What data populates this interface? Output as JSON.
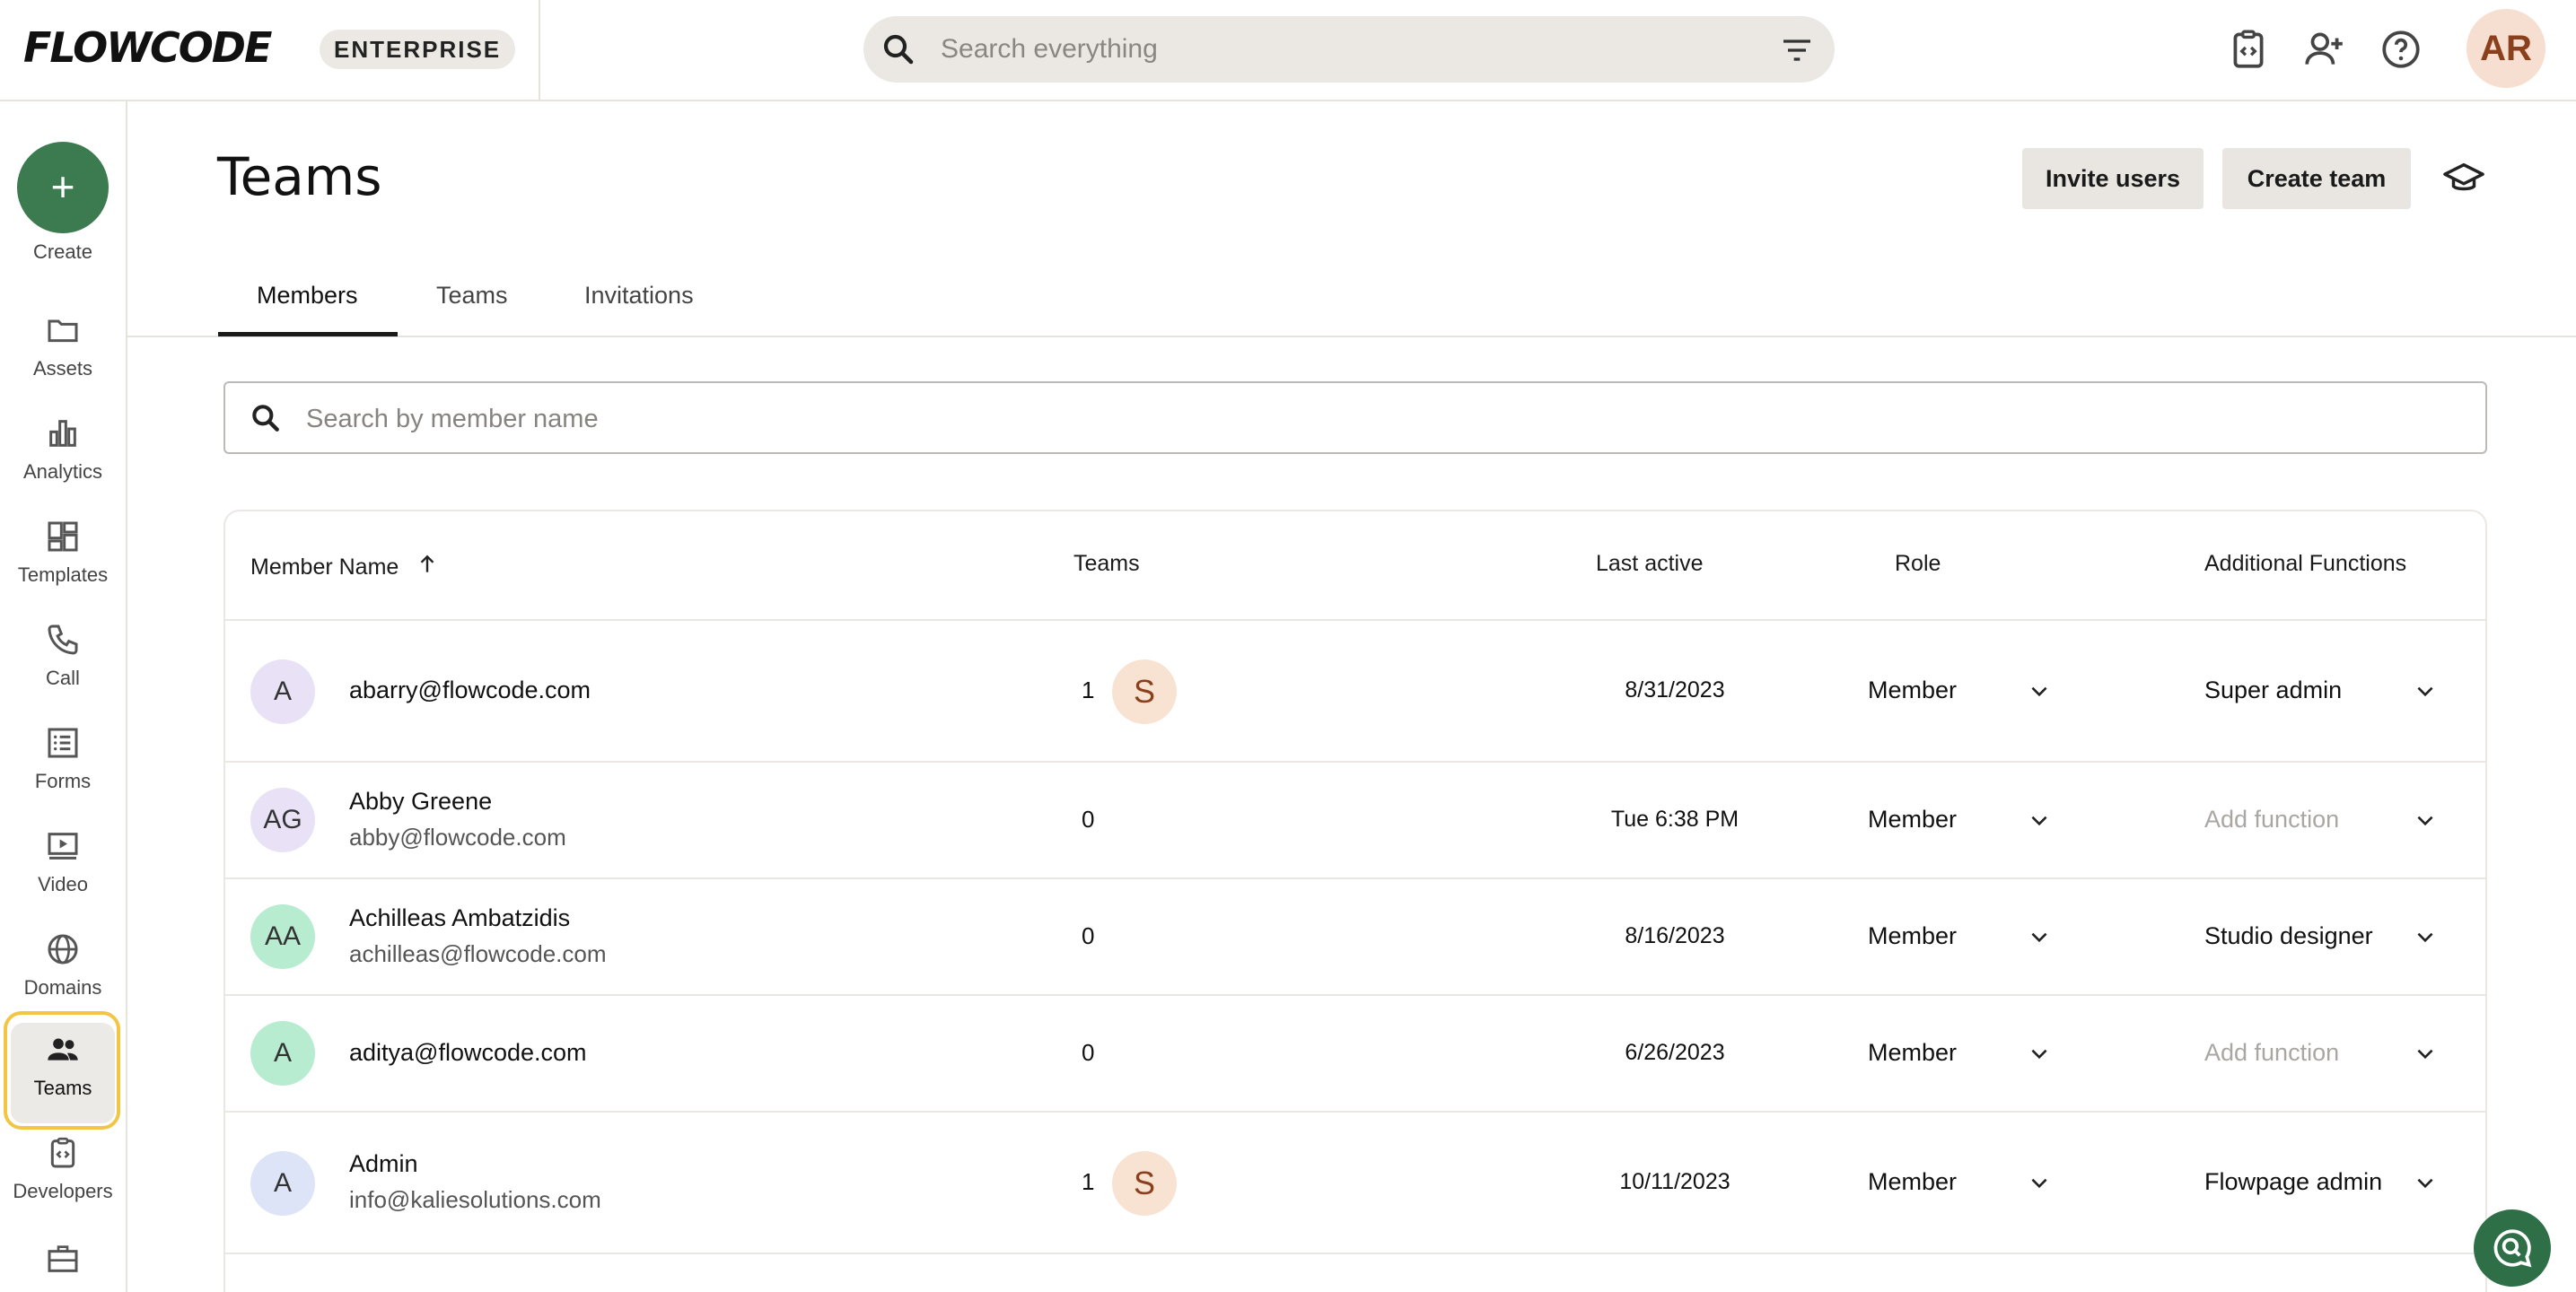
{
  "brand": {
    "logo": "FLOWCODE",
    "plan_badge": "ENTERPRISE"
  },
  "search": {
    "placeholder": "Search everything"
  },
  "user": {
    "initials": "AR"
  },
  "sidebar": {
    "create_label": "Create",
    "items": [
      {
        "label": "Assets",
        "icon": "folder-icon"
      },
      {
        "label": "Analytics",
        "icon": "bar-chart-icon"
      },
      {
        "label": "Templates",
        "icon": "dashboard-icon"
      },
      {
        "label": "Call",
        "icon": "phone-icon"
      },
      {
        "label": "Forms",
        "icon": "form-icon"
      },
      {
        "label": "Video",
        "icon": "video-icon"
      },
      {
        "label": "Domains",
        "icon": "globe-icon"
      },
      {
        "label": "Teams",
        "icon": "people-icon",
        "active": true
      },
      {
        "label": "Developers",
        "icon": "code-icon"
      }
    ]
  },
  "page": {
    "title": "Teams",
    "invite_label": "Invite users",
    "create_team_label": "Create team",
    "tabs": [
      "Members",
      "Teams",
      "Invitations"
    ],
    "active_tab": "Members",
    "member_search_placeholder": "Search by member name"
  },
  "table": {
    "headers": {
      "name": "Member Name",
      "teams": "Teams",
      "last_active": "Last active",
      "role": "Role",
      "functions": "Additional Functions"
    },
    "rows": [
      {
        "initials": "A",
        "avatar_color": "#e9e1f5",
        "name": "abarry@flowcode.com",
        "email": "",
        "teams_count": "1",
        "team_badge": "S",
        "last_active": "8/31/2023",
        "role": "Member",
        "function": "Super admin",
        "function_placeholder": false
      },
      {
        "initials": "AG",
        "avatar_color": "#e9e1f5",
        "name": "Abby Greene",
        "email": "abby@flowcode.com",
        "teams_count": "0",
        "team_badge": "",
        "last_active": "Tue 6:38 PM",
        "role": "Member",
        "function": "Add function",
        "function_placeholder": true
      },
      {
        "initials": "AA",
        "avatar_color": "#b7ecd0",
        "name": "Achilleas Ambatzidis",
        "email": "achilleas@flowcode.com",
        "teams_count": "0",
        "team_badge": "",
        "last_active": "8/16/2023",
        "role": "Member",
        "function": "Studio designer",
        "function_placeholder": false
      },
      {
        "initials": "A",
        "avatar_color": "#b7ecd0",
        "name": "aditya@flowcode.com",
        "email": "",
        "teams_count": "0",
        "team_badge": "",
        "last_active": "6/26/2023",
        "role": "Member",
        "function": "Add function",
        "function_placeholder": true
      },
      {
        "initials": "A",
        "avatar_color": "#dde4f8",
        "name": "Admin",
        "email": "info@kaliesolutions.com",
        "teams_count": "1",
        "team_badge": "S",
        "last_active": "10/11/2023",
        "role": "Member",
        "function": "Flowpage admin",
        "function_placeholder": false
      }
    ]
  },
  "colors": {
    "accent_green": "#3c7b4f",
    "highlight_ring": "#f3c545"
  }
}
